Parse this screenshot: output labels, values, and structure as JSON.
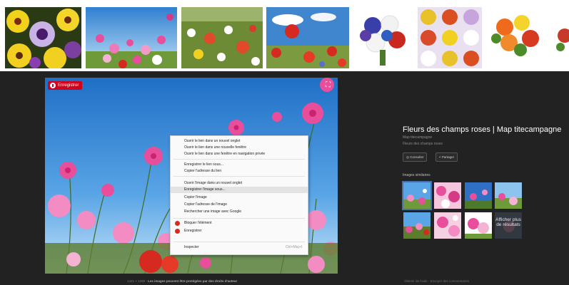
{
  "thumbnails": [
    {
      "name": "pansies",
      "colors": [
        "#2a3a14",
        "#f2d11b",
        "#6b3fa0"
      ]
    },
    {
      "name": "cosmos-sky",
      "colors": [
        "#3d8ed8",
        "#e94e9b",
        "#6e9a3a"
      ]
    },
    {
      "name": "poppy-meadow",
      "colors": [
        "#6d8a35",
        "#e04a2a",
        "#f3eedc"
      ]
    },
    {
      "name": "poppy-sky",
      "colors": [
        "#3f86cf",
        "#d62a20",
        "#7c9b40"
      ]
    },
    {
      "name": "blue-bouquet",
      "colors": [
        "#ffffff",
        "#3a3ea8",
        "#f0f0f0"
      ]
    },
    {
      "name": "flower-grid",
      "colors": [
        "#e9c12a",
        "#d94f1f",
        "#e9e1ef"
      ]
    },
    {
      "name": "orange-bouquet",
      "colors": [
        "#ffffff",
        "#ef6a1c",
        "#4d8a2a"
      ]
    },
    {
      "name": "partial",
      "colors": [
        "#ffffff",
        "#c63a2a",
        "#4d8a2a"
      ]
    }
  ],
  "viewer": {
    "save_badge": "Enregistrer",
    "title": "Fleurs des champs roses | Map titecampagne",
    "site": "Map titecampagne",
    "subtitle": "Fleurs des champs roses",
    "visit_button": "Consulter",
    "share_button": "Partager",
    "similar_label": "Images similaires",
    "more_label": "Afficher plus de résultats",
    "caption_size": "1421 × 1280 -",
    "caption_rights": "Les images peuvent être protégées par des droits d'auteur",
    "footer_links": "Obtenir de l'aide · Envoyer des commentaires"
  },
  "context_menu": {
    "items": [
      {
        "label": "Ouvrir le lien dans un nouvel onglet"
      },
      {
        "label": "Ouvrir le lien dans une nouvelle fenêtre"
      },
      {
        "label": "Ouvrir le lien dans une fenêtre en navigation privée"
      },
      {
        "label": "Enregistrer le lien sous..."
      },
      {
        "label": "Copier l'adresse du lien"
      },
      {
        "label": "Ouvrir l'image dans un nouvel onglet"
      },
      {
        "label": "Enregistrer l'image sous..."
      },
      {
        "label": "Copier l'image"
      },
      {
        "label": "Copier l'adresse de l'image"
      },
      {
        "label": "Rechercher une image avec Google"
      },
      {
        "label": "Bloquer l'élément"
      },
      {
        "label": "Enregistrer"
      },
      {
        "label": "Inspecter"
      }
    ],
    "inspect_shortcut": "Ctrl+Maj+I"
  },
  "colors": {
    "viewer_bg": "#222222",
    "accent_red": "#d0021b",
    "sky_blue": "#4c96e0",
    "pink_flower": "#e94e9b"
  }
}
